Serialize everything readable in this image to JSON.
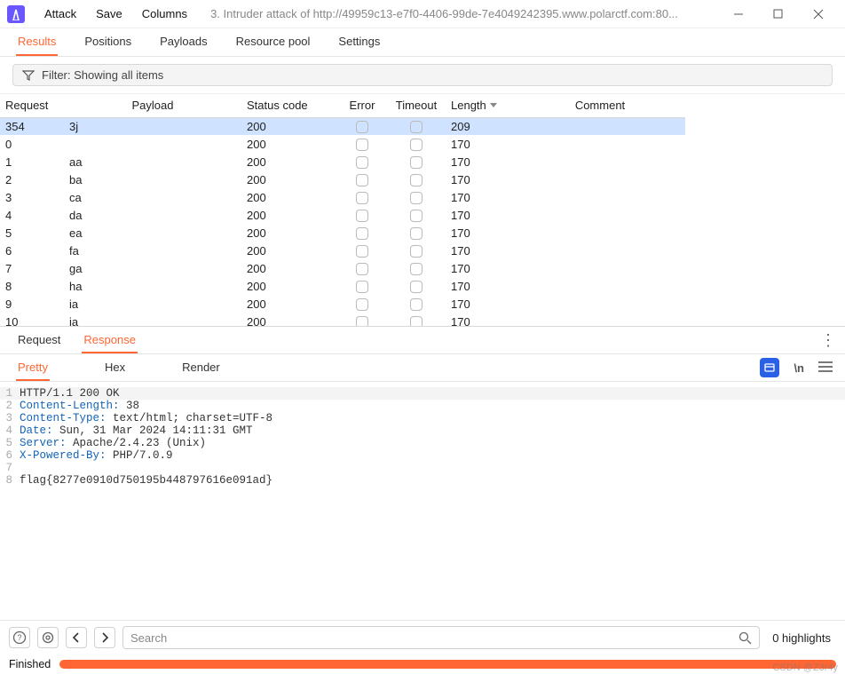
{
  "menu": {
    "attack": "Attack",
    "save": "Save",
    "columns": "Columns"
  },
  "window_title": "3. Intruder attack of http://49959c13-e7f0-4406-99de-7e4049242395.www.polarctf.com:80...",
  "tabs": {
    "results": "Results",
    "positions": "Positions",
    "payloads": "Payloads",
    "resource_pool": "Resource pool",
    "settings": "Settings"
  },
  "filter_text": "Filter: Showing all items",
  "table": {
    "headers": {
      "request": "Request",
      "payload": "Payload",
      "status": "Status code",
      "error": "Error",
      "timeout": "Timeout",
      "length": "Length",
      "comment": "Comment"
    },
    "rows": [
      {
        "req": "354",
        "payload": "3j",
        "status": "200",
        "length": "209",
        "selected": true
      },
      {
        "req": "0",
        "payload": "",
        "status": "200",
        "length": "170"
      },
      {
        "req": "1",
        "payload": "aa",
        "status": "200",
        "length": "170"
      },
      {
        "req": "2",
        "payload": "ba",
        "status": "200",
        "length": "170"
      },
      {
        "req": "3",
        "payload": "ca",
        "status": "200",
        "length": "170"
      },
      {
        "req": "4",
        "payload": "da",
        "status": "200",
        "length": "170"
      },
      {
        "req": "5",
        "payload": "ea",
        "status": "200",
        "length": "170"
      },
      {
        "req": "6",
        "payload": "fa",
        "status": "200",
        "length": "170"
      },
      {
        "req": "7",
        "payload": "ga",
        "status": "200",
        "length": "170"
      },
      {
        "req": "8",
        "payload": "ha",
        "status": "200",
        "length": "170"
      },
      {
        "req": "9",
        "payload": "ia",
        "status": "200",
        "length": "170"
      },
      {
        "req": "10",
        "payload": "ja",
        "status": "200",
        "length": "170"
      }
    ]
  },
  "subtabs": {
    "request": "Request",
    "response": "Response"
  },
  "fmttabs": {
    "pretty": "Pretty",
    "hex": "Hex",
    "render": "Render"
  },
  "response": {
    "l1": "HTTP/1.1 200 OK",
    "l2k": "Content-Length:",
    "l2v": " 38",
    "l3k": "Content-Type:",
    "l3v": " text/html; charset=UTF-8",
    "l4k": "Date:",
    "l4v": " Sun, 31 Mar 2024 14:11:31 GMT",
    "l5k": "Server:",
    "l5v": " Apache/2.4.23 (Unix)",
    "l6k": "X-Powered-By:",
    "l6v": " PHP/7.0.9",
    "l7": "",
    "l8": "flag{8277e0910d750195b448797616e091ad}"
  },
  "search_placeholder": "Search",
  "highlights": "0 highlights",
  "status_text": "Finished",
  "watermark": "CSDN @Z3r4y",
  "ln": {
    "n1": "1",
    "n2": "2",
    "n3": "3",
    "n4": "4",
    "n5": "5",
    "n6": "6",
    "n7": "7",
    "n8": "8"
  },
  "newline_sym": "\\n"
}
